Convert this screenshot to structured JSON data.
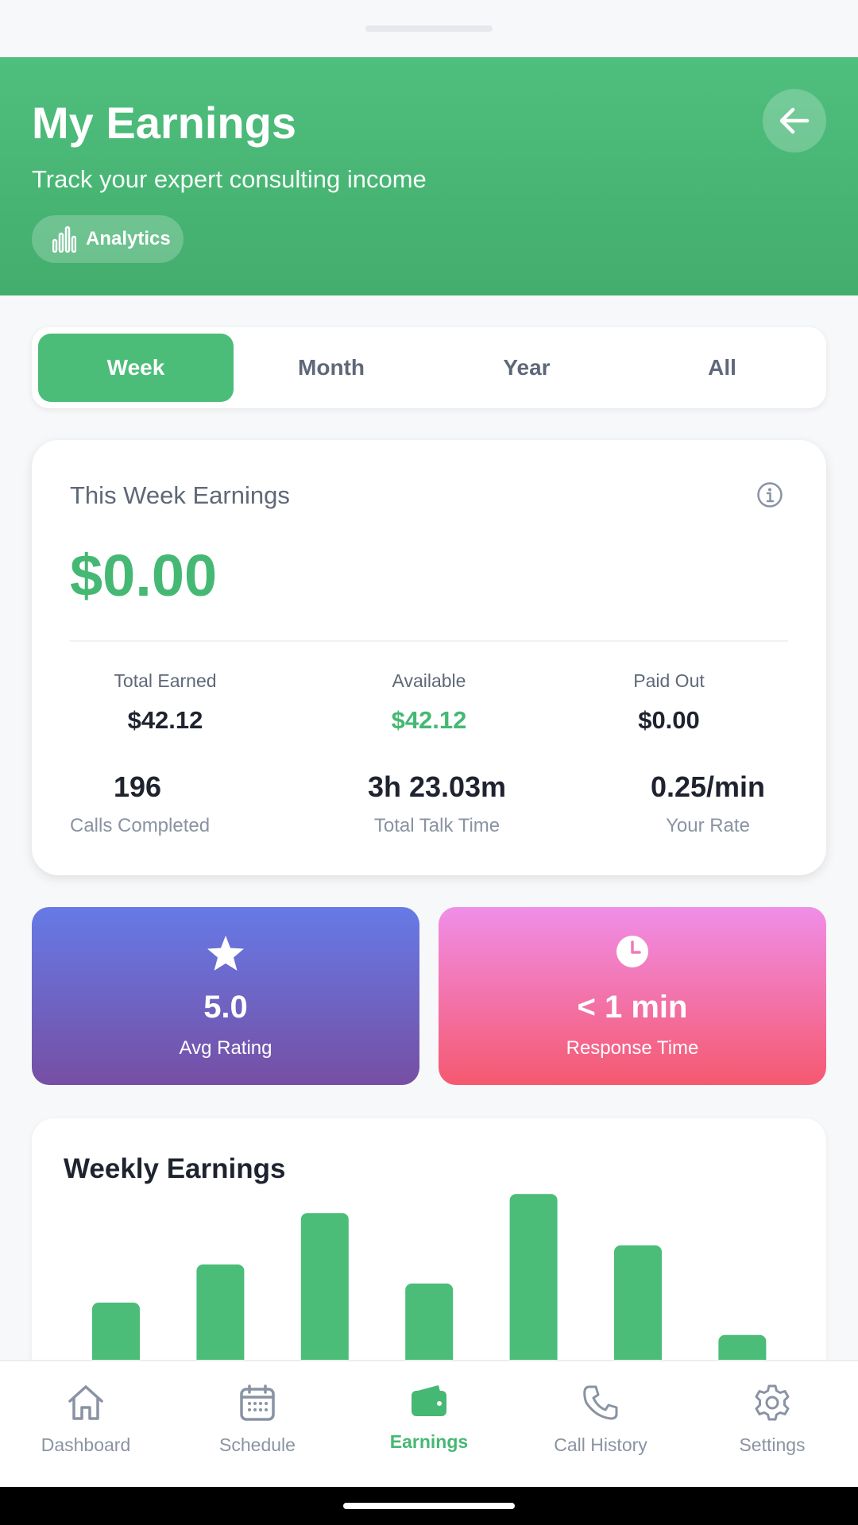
{
  "header": {
    "title": "My Earnings",
    "subtitle": "Track your expert consulting income",
    "analytics_label": "Analytics",
    "back_icon": "arrow-left-icon",
    "color": "#4bbd78"
  },
  "period_tabs": [
    {
      "label": "Week",
      "active": true
    },
    {
      "label": "Month",
      "active": false
    },
    {
      "label": "Year",
      "active": false
    },
    {
      "label": "All",
      "active": false
    }
  ],
  "summary": {
    "label": "This Week Earnings",
    "amount": "$0.00",
    "stats": [
      {
        "label": "Total Earned",
        "value": "$42.12"
      },
      {
        "label": "Available",
        "value": "$42.12"
      },
      {
        "label": "Paid Out",
        "value": "$0.00"
      }
    ],
    "metrics": [
      {
        "value": "196",
        "label": "Calls Completed"
      },
      {
        "value": "3h 23.03m",
        "label": "Total Talk Time"
      },
      {
        "value": "0.25/min",
        "label": "Your Rate"
      }
    ]
  },
  "tiles": {
    "rating": {
      "icon": "star-icon",
      "value": "5.0",
      "label": "Avg Rating"
    },
    "response": {
      "icon": "clock-icon",
      "value": "< 1 min",
      "label": "Response Time"
    }
  },
  "weekly_chart": {
    "title": "Weekly Earnings",
    "bar_color": "#4bbd78",
    "relative_heights": [
      0.3,
      0.5,
      0.77,
      0.4,
      0.87,
      0.6,
      0.13
    ]
  },
  "bottom_nav": [
    {
      "label": "Dashboard",
      "icon": "home-icon",
      "active": false
    },
    {
      "label": "Schedule",
      "icon": "calendar-icon",
      "active": false
    },
    {
      "label": "Earnings",
      "icon": "wallet-icon",
      "active": true
    },
    {
      "label": "Call History",
      "icon": "phone-icon",
      "active": false
    },
    {
      "label": "Settings",
      "icon": "gear-icon",
      "active": false
    }
  ]
}
